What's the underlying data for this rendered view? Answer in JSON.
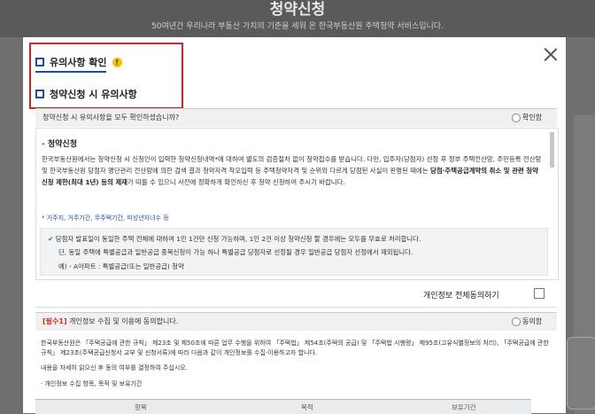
{
  "background": {
    "title": "청약신청",
    "subtitle": "50여년간 우리나라 부동산 가치의 기준을 세워 온 한국부동산원 주택청약 서비스입니다."
  },
  "modal": {
    "heading1": "유의사항 확인",
    "heading2": "청약신청 시 유의사항",
    "confirm_question": "청약신청 시 유의사항을 모두 확인하셨습니까?",
    "confirm_label": "확인함",
    "section_title": "청약신청",
    "section_paragraph_a": "한국부동산원에서는 청약신청 시 신청인이 입력한 청약신청내역*에 대하여 별도의 검증절차 없이 청약접수를 받습니다. 다만, 입주자(당첨자) 선정 후 정부 주택전산망, 주민등록 전산망 및 한국부동산원 당첨자 명단관리 전산망에 의한 검색 결과 청약자격 착오입력 등 주택청약자격 및 순위와 다르게 당첨된 사실이 판명된 때에는 ",
    "section_paragraph_bold": "당첨·주택공급계약의 취소 및 관련 청약신청 제한(최대 1년) 등의 제재",
    "section_paragraph_b": "가 따를 수 있으니 사전에 정확하게 확인하신 후 청약 신청하여 주시기 바랍니다.",
    "note": "* 거주지, 거주기간, 무주택기간, 미성년자녀수 등",
    "check_line1": "당첨자 발표일이 동일한 주택 전체에 대하여 1인 1건만 신청 가능하며, 1인 2건 이상 청약신청 할 경우에는 모두를 무효로 처리합니다.",
    "check_line2": "단, 동일 주택에 특별공급과 일반공급 중복신청이 가능 하나 특별공급 당첨자로 선정될 경우 일반공급 당첨자 선정에서 제외됩니다.",
    "check_line3": "예) - A아파트 : 특별공급(또는 일반공급) 청약",
    "agree_all_label": "개인정보 전체동의하기",
    "required_tag": "[필수1]",
    "required_title": "개인정보 수집 및 이용에 동의합니다.",
    "agree_label": "동의함",
    "privacy_p1": "한국부동산원은 「주택공급에 관한 규칙」 제23조 및 제50조에 따른 업무 수행을 위하여 「주택법」 제54조(주택의 공급) 및 「주택법 시행령」 제95조(고유식별정보의 처리), 「주택공급에 관한 규칙」 제23조(주택공급신청서 교부 및 신청서류)에 따라 다음과 같이 개인정보를 수집·이용하고자 합니다.",
    "privacy_p2": "내용을 자세히 읽으신 후 동의 여부를 결정하여 주십시오.",
    "privacy_p3": "· 개인정보 수집 항목, 목적 및 보유기간",
    "table_col1": "항목",
    "table_col2": "목적",
    "table_col3": "보유기간"
  },
  "colors": {
    "accent": "#1f4e9a",
    "highlight_border": "#d4222a",
    "warning": "#f2c200"
  }
}
